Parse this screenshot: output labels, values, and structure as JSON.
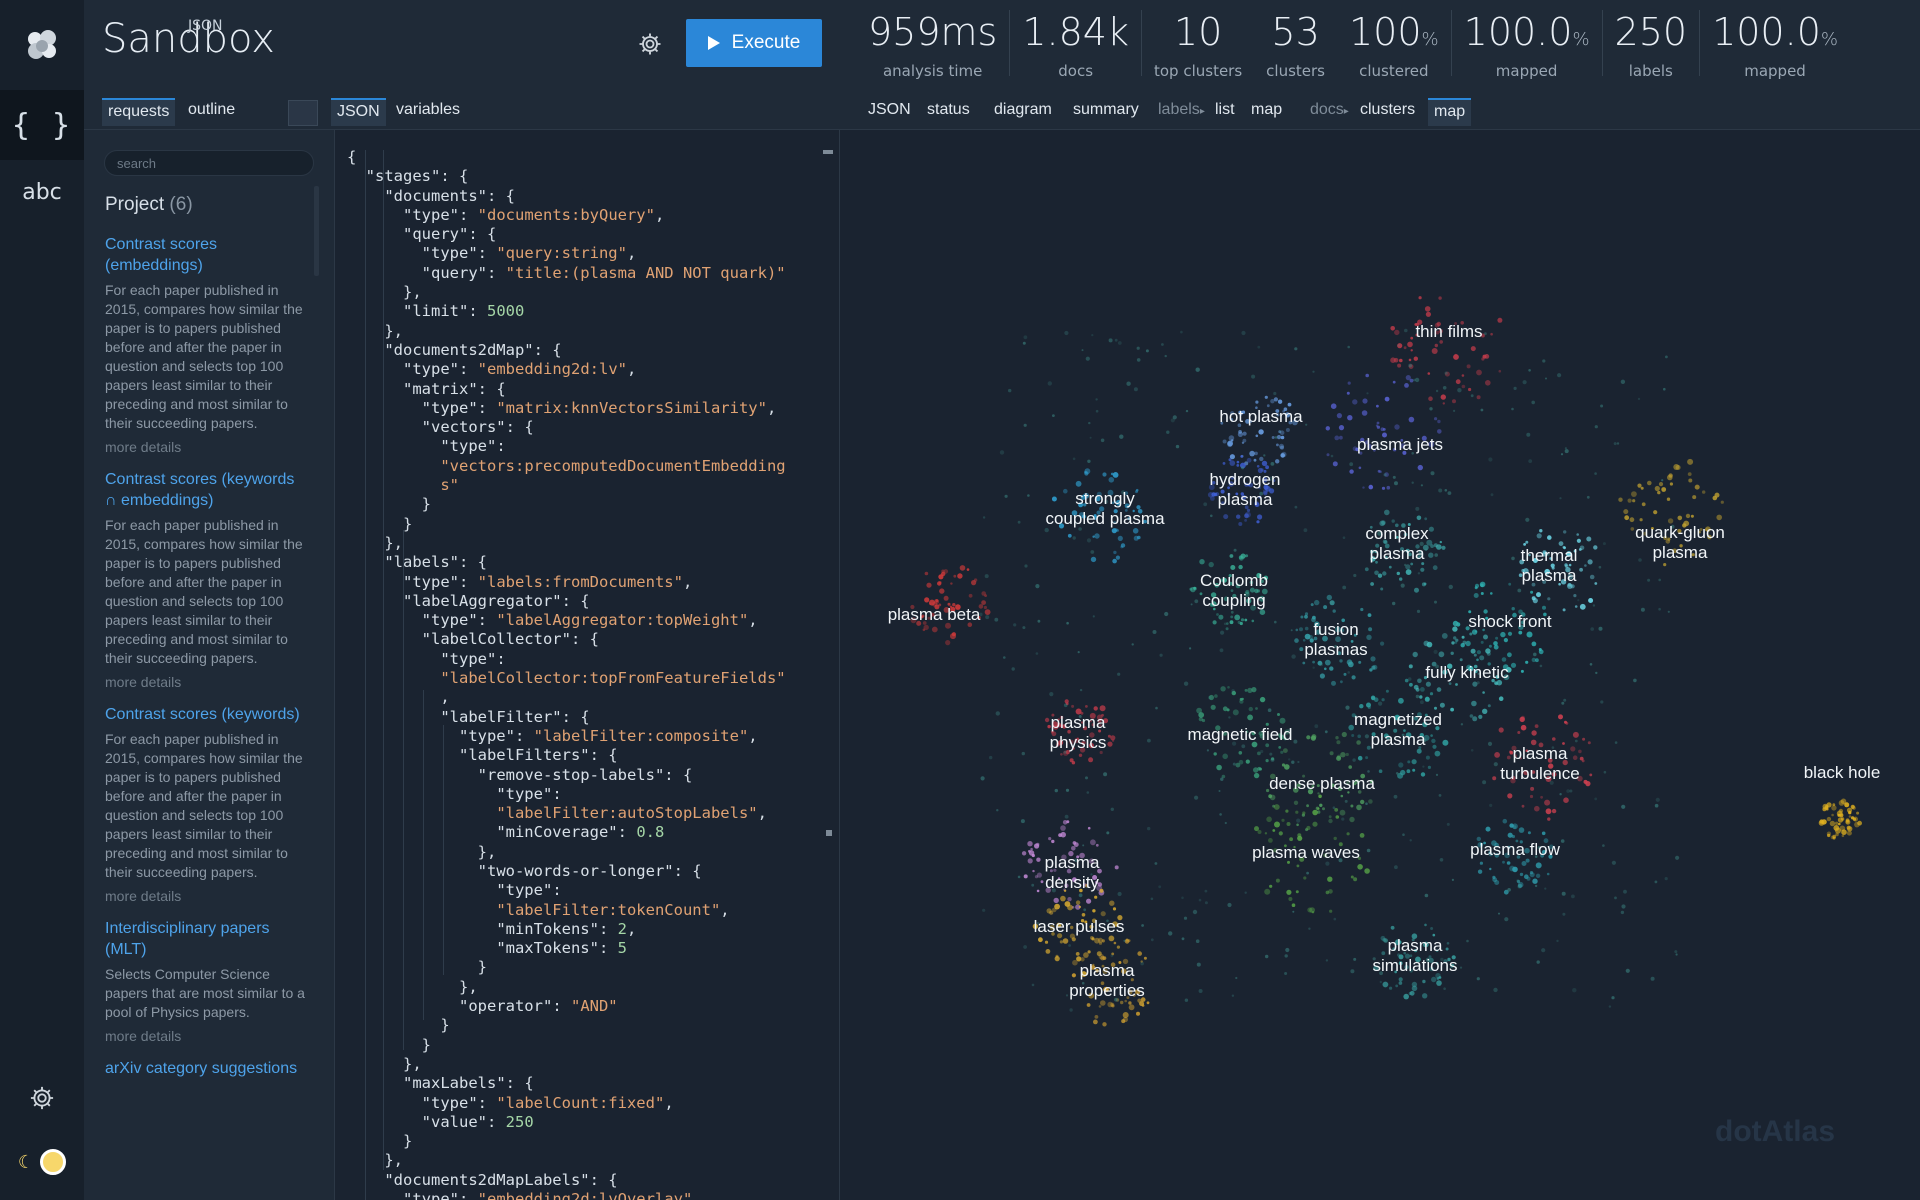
{
  "app": {
    "title_main": "Sandbox",
    "title_super": "JSON",
    "execute_label": "Execute",
    "brand_mark": "dotAtlas"
  },
  "rail": {
    "json_glyph": "{ }",
    "abc_label": "abc"
  },
  "stats": [
    {
      "value": "959ms",
      "unit": "",
      "label": "analysis time"
    },
    {
      "value": "1.84k",
      "unit": "",
      "label": "docs"
    },
    {
      "value": "10",
      "unit": "",
      "label": "top clusters"
    },
    {
      "value": "53",
      "unit": "",
      "label": "clusters"
    },
    {
      "value": "100",
      "unit": "%",
      "label": "clustered"
    },
    {
      "value": "100.0",
      "unit": "%",
      "label": "mapped"
    },
    {
      "value": "250",
      "unit": "",
      "label": "labels"
    },
    {
      "value": "100.0",
      "unit": "%",
      "label": "mapped"
    }
  ],
  "tabs": {
    "requests": "requests",
    "outline": "outline",
    "json": "JSON",
    "variables": "variables",
    "r_json": "JSON",
    "r_status": "status",
    "r_diagram": "diagram",
    "r_summary": "summary",
    "r_labels": "labels",
    "r_list": "list",
    "r_map": "map",
    "r_docs": "docs",
    "r_clusters": "clusters",
    "r_map2": "map"
  },
  "sidebar": {
    "search_placeholder": "search",
    "project_name": "Project",
    "project_count": "(6)",
    "entries": [
      {
        "title": "Contrast scores (embeddings)",
        "desc": "For each paper published in 2015, compares how similar the paper is to papers published before and after the paper in question and selects top 100 papers least similar to their preceding and most similar to their succeeding papers.",
        "more": "more details"
      },
      {
        "title": "Contrast scores (keywords ∩ embeddings)",
        "desc": "For each paper published in 2015, compares how similar the paper is to papers published before and after the paper in question and selects top 100 papers least similar to their preceding and most similar to their succeeding papers.",
        "more": "more details"
      },
      {
        "title": "Contrast scores (keywords)",
        "desc": "For each paper published in 2015, compares how similar the paper is to papers published before and after the paper in question and selects top 100 papers least similar to their preceding and most similar to their succeeding papers.",
        "more": "more details"
      },
      {
        "title": "Interdisciplinary papers (MLT)",
        "desc": "Selects Computer Science papers that are most similar to a pool of Physics papers.",
        "more": "more details"
      },
      {
        "title": "arXiv category suggestions",
        "desc": "",
        "more": ""
      }
    ]
  },
  "map_labels": [
    "thin films",
    "hot plasma",
    "plasma jets",
    "hydrogen",
    "plasma",
    "strongly",
    "coupled plasma",
    "complex",
    "plasma",
    "thermal",
    "plasma",
    "quark-gluon",
    "plasma",
    "Coulomb",
    "coupling",
    "plasma beta",
    "fusion",
    "plasmas",
    "shock front",
    "fully kinetic",
    "plasma",
    "physics",
    "magnetic field",
    "magnetized",
    "plasma",
    "plasma",
    "turbulence",
    "black hole",
    "dense plasma",
    "plasma",
    "density",
    "plasma waves",
    "plasma flow",
    "laser pulses",
    "plasma",
    "simulations",
    "plasma",
    "properties"
  ],
  "colors": {
    "accent": "#2b87d8",
    "link": "#4ea3ea",
    "string": "#e0a273",
    "number": "#a5d6a7"
  }
}
